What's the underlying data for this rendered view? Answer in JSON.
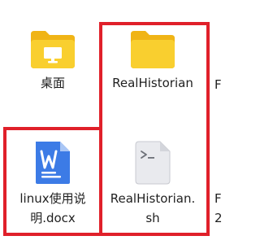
{
  "desktop": {
    "items": [
      {
        "label": "桌面",
        "icon": "desktop-folder-icon"
      },
      {
        "label": "RealHistorian",
        "icon": "folder-icon"
      },
      {
        "label_line1": "linux使用说",
        "label_line2": "明.docx",
        "icon": "word-document-icon"
      },
      {
        "label_line1": "RealHistorian.",
        "label_line2": "sh",
        "icon": "shell-script-icon"
      }
    ],
    "cut_off": {
      "row1": "F",
      "row2_line1": "F",
      "row2_line2": "2"
    }
  },
  "colors": {
    "annotation": "#e0202a",
    "folder_body": "#f9cf2f",
    "folder_back": "#f0b416",
    "word_blue": "#3c7be6",
    "script_grey": "#e9eaee"
  }
}
